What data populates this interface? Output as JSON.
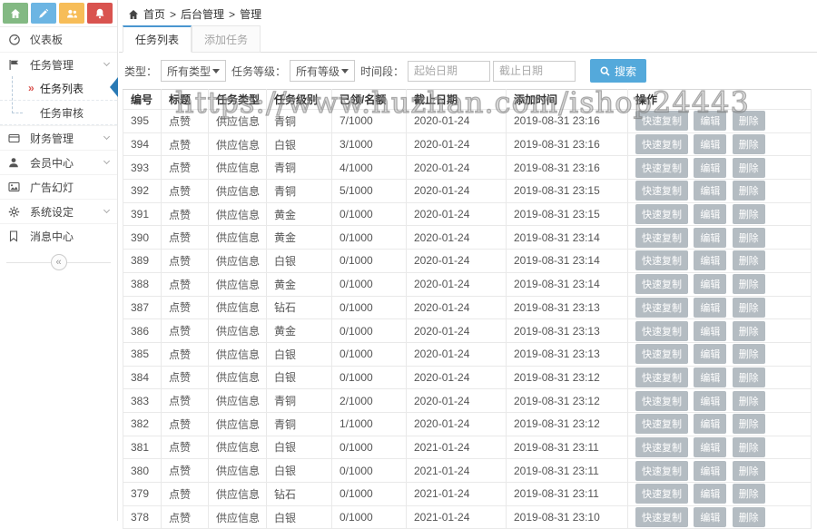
{
  "quick_actions": [
    {
      "name": "home",
      "color": "#83b983"
    },
    {
      "name": "edit",
      "color": "#6cb5e3"
    },
    {
      "name": "users",
      "color": "#f7bd58"
    },
    {
      "name": "notifications",
      "color": "#d9534f"
    }
  ],
  "breadcrumb": {
    "separator": ">",
    "items": [
      "首页",
      "后台管理",
      "管理"
    ]
  },
  "sidebar": {
    "active_marker": "»",
    "collapse_glyph": "«",
    "items": [
      {
        "label": "仪表板",
        "icon": "gauge-icon",
        "expandable": false
      },
      {
        "label": "任务管理",
        "icon": "flag-icon",
        "expandable": true,
        "expanded": true,
        "children": [
          {
            "label": "任务列表",
            "active": true
          },
          {
            "label": "任务审核",
            "active": false
          }
        ]
      },
      {
        "label": "财务管理",
        "icon": "wallet-icon",
        "expandable": true
      },
      {
        "label": "会员中心",
        "icon": "user-icon",
        "expandable": true
      },
      {
        "label": "广告幻灯",
        "icon": "image-icon",
        "expandable": false
      },
      {
        "label": "系统设定",
        "icon": "gear-icon",
        "expandable": true
      },
      {
        "label": "消息中心",
        "icon": "bookmark-icon",
        "expandable": false
      }
    ]
  },
  "tabs": [
    {
      "label": "任务列表",
      "active": true
    },
    {
      "label": "添加任务",
      "active": false
    }
  ],
  "filters": {
    "type_label": "类型：",
    "type_value": "所有类型",
    "level_label": "任务等级：",
    "level_value": "所有等级",
    "period_label": "时间段：",
    "start_placeholder": "起始日期",
    "end_placeholder": "截止日期",
    "search_label": "搜索"
  },
  "table": {
    "columns": [
      "编号",
      "标题",
      "任务类型",
      "任务级别",
      "已领/名额",
      "截止日期",
      "添加时间",
      "操作"
    ],
    "actions": [
      "快速复制",
      "编辑",
      "删除"
    ],
    "rows": [
      {
        "id": "395",
        "title": "点赞",
        "type": "供应信息",
        "level": "青铜",
        "quota": "7/1000",
        "deadline": "2020-01-24",
        "created": "2019-08-31 23:16"
      },
      {
        "id": "394",
        "title": "点赞",
        "type": "供应信息",
        "level": "白银",
        "quota": "3/1000",
        "deadline": "2020-01-24",
        "created": "2019-08-31 23:16"
      },
      {
        "id": "393",
        "title": "点赞",
        "type": "供应信息",
        "level": "青铜",
        "quota": "4/1000",
        "deadline": "2020-01-24",
        "created": "2019-08-31 23:16"
      },
      {
        "id": "392",
        "title": "点赞",
        "type": "供应信息",
        "level": "青铜",
        "quota": "5/1000",
        "deadline": "2020-01-24",
        "created": "2019-08-31 23:15"
      },
      {
        "id": "391",
        "title": "点赞",
        "type": "供应信息",
        "level": "黄金",
        "quota": "0/1000",
        "deadline": "2020-01-24",
        "created": "2019-08-31 23:15"
      },
      {
        "id": "390",
        "title": "点赞",
        "type": "供应信息",
        "level": "黄金",
        "quota": "0/1000",
        "deadline": "2020-01-24",
        "created": "2019-08-31 23:14"
      },
      {
        "id": "389",
        "title": "点赞",
        "type": "供应信息",
        "level": "白银",
        "quota": "0/1000",
        "deadline": "2020-01-24",
        "created": "2019-08-31 23:14"
      },
      {
        "id": "388",
        "title": "点赞",
        "type": "供应信息",
        "level": "黄金",
        "quota": "0/1000",
        "deadline": "2020-01-24",
        "created": "2019-08-31 23:14"
      },
      {
        "id": "387",
        "title": "点赞",
        "type": "供应信息",
        "level": "钻石",
        "quota": "0/1000",
        "deadline": "2020-01-24",
        "created": "2019-08-31 23:13"
      },
      {
        "id": "386",
        "title": "点赞",
        "type": "供应信息",
        "level": "黄金",
        "quota": "0/1000",
        "deadline": "2020-01-24",
        "created": "2019-08-31 23:13"
      },
      {
        "id": "385",
        "title": "点赞",
        "type": "供应信息",
        "level": "白银",
        "quota": "0/1000",
        "deadline": "2020-01-24",
        "created": "2019-08-31 23:13"
      },
      {
        "id": "384",
        "title": "点赞",
        "type": "供应信息",
        "level": "白银",
        "quota": "0/1000",
        "deadline": "2020-01-24",
        "created": "2019-08-31 23:12"
      },
      {
        "id": "383",
        "title": "点赞",
        "type": "供应信息",
        "level": "青铜",
        "quota": "2/1000",
        "deadline": "2020-01-24",
        "created": "2019-08-31 23:12"
      },
      {
        "id": "382",
        "title": "点赞",
        "type": "供应信息",
        "level": "青铜",
        "quota": "1/1000",
        "deadline": "2020-01-24",
        "created": "2019-08-31 23:12"
      },
      {
        "id": "381",
        "title": "点赞",
        "type": "供应信息",
        "level": "白银",
        "quota": "0/1000",
        "deadline": "2021-01-24",
        "created": "2019-08-31 23:11"
      },
      {
        "id": "380",
        "title": "点赞",
        "type": "供应信息",
        "level": "白银",
        "quota": "0/1000",
        "deadline": "2021-01-24",
        "created": "2019-08-31 23:11"
      },
      {
        "id": "379",
        "title": "点赞",
        "type": "供应信息",
        "level": "钻石",
        "quota": "0/1000",
        "deadline": "2021-01-24",
        "created": "2019-08-31 23:11"
      },
      {
        "id": "378",
        "title": "点赞",
        "type": "供应信息",
        "level": "白银",
        "quota": "0/1000",
        "deadline": "2021-01-24",
        "created": "2019-08-31 23:10"
      }
    ]
  },
  "watermark": "https://www.huzhan.com/ishop24443",
  "colors": {
    "tab_accent": "#4a96d0",
    "search_button": "#54a9db",
    "action_button": "#b4bcc2",
    "active_marker_red": "#d9534f",
    "pointer_blue": "#2a7ab5"
  }
}
